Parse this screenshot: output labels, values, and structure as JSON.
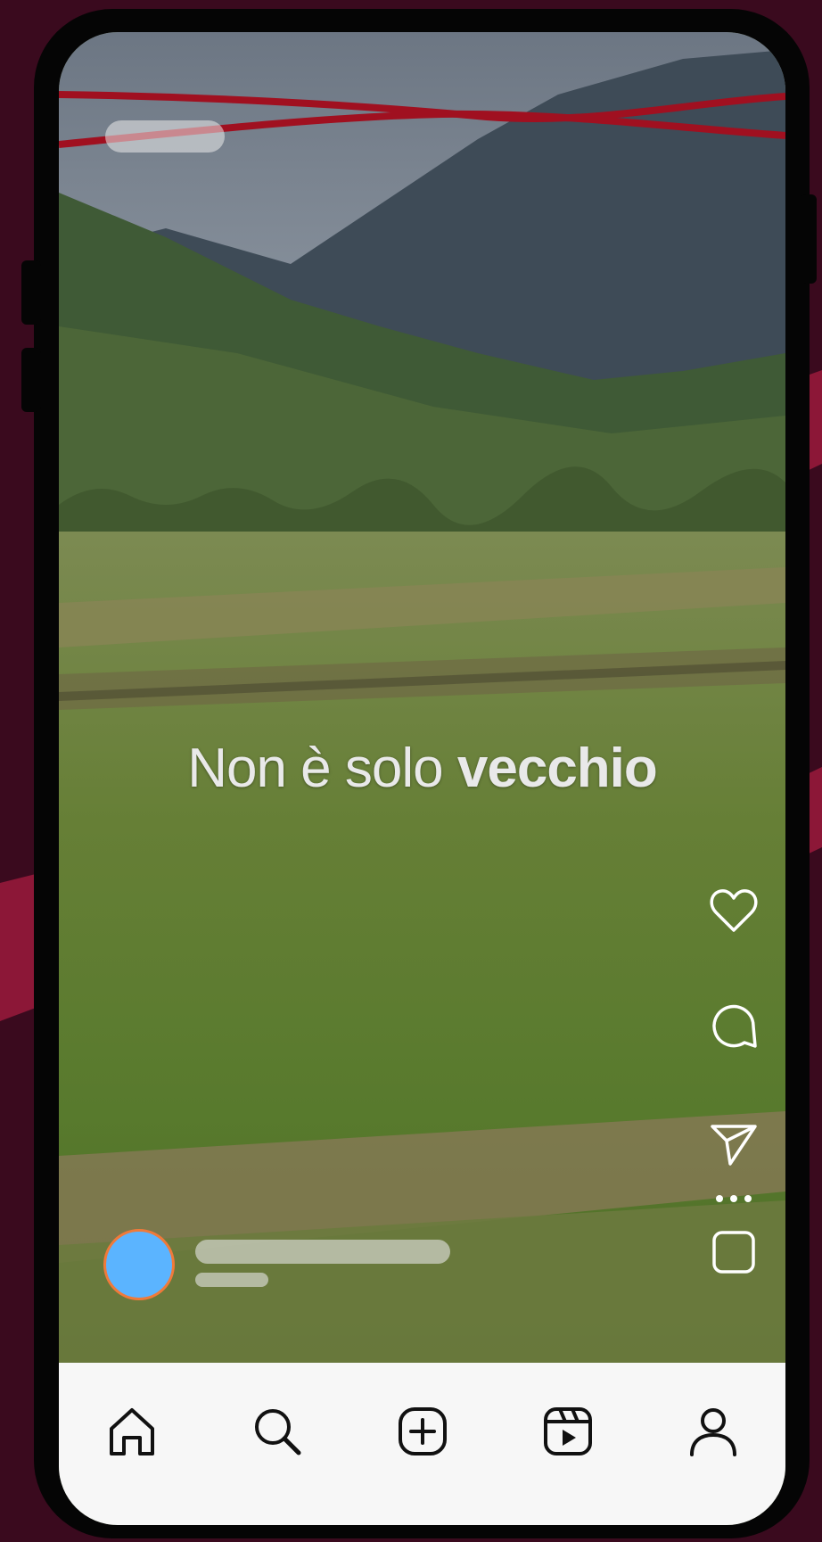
{
  "caption": {
    "light": "Non è solo",
    "bold": "vecchio"
  },
  "colors": {
    "background": "#3a0a1e",
    "accent": "#8c1737",
    "avatar_fill": "#5bb4ff",
    "avatar_ring": "#f07a3a",
    "tabbar": "#f7f7f7"
  },
  "actions": [
    {
      "icon": "heart-icon"
    },
    {
      "icon": "comment-icon"
    },
    {
      "icon": "share-icon"
    },
    {
      "icon": "more-icon"
    },
    {
      "icon": "audio-square-icon"
    }
  ],
  "tabs": [
    {
      "icon": "home-icon"
    },
    {
      "icon": "search-icon"
    },
    {
      "icon": "create-icon"
    },
    {
      "icon": "reels-icon"
    },
    {
      "icon": "profile-icon"
    }
  ]
}
